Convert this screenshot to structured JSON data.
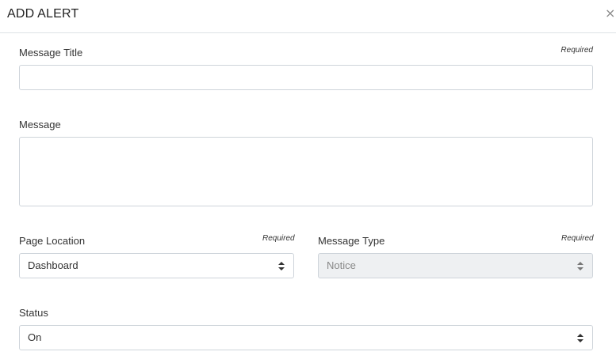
{
  "modal": {
    "title": "ADD ALERT",
    "close_glyph": "×"
  },
  "fields": {
    "message_title": {
      "label": "Message Title",
      "required_text": "Required",
      "value": "",
      "placeholder": ""
    },
    "message": {
      "label": "Message",
      "value": "",
      "placeholder": ""
    },
    "page_location": {
      "label": "Page Location",
      "required_text": "Required",
      "selected": "Dashboard"
    },
    "message_type": {
      "label": "Message Type",
      "required_text": "Required",
      "selected": "Notice",
      "disabled": true
    },
    "status": {
      "label": "Status",
      "selected": "On"
    }
  },
  "icons": {
    "close": "close-icon",
    "select_arrows": "sort-arrows-icon"
  },
  "colors": {
    "border": "#ced4da",
    "disabled_background": "#eef0f2",
    "header_divider": "#dee2e6"
  }
}
